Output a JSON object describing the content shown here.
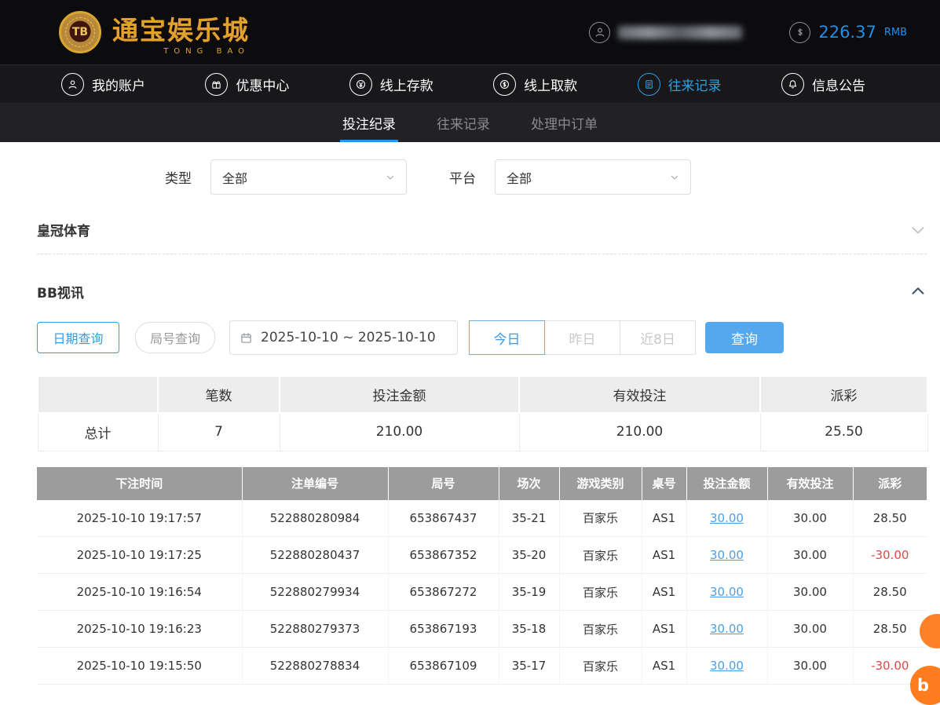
{
  "header": {
    "logo": {
      "badge": "TB",
      "title": "通宝娱乐城",
      "subtitle": "TONG BAO"
    },
    "balance": {
      "amount": "226.37",
      "currency": "RMB"
    }
  },
  "nav": {
    "items": [
      {
        "label": "我的账户",
        "icon": "account-icon",
        "active": false
      },
      {
        "label": "优惠中心",
        "icon": "promo-icon",
        "active": false
      },
      {
        "label": "线上存款",
        "icon": "deposit-icon",
        "active": false
      },
      {
        "label": "线上取款",
        "icon": "withdraw-icon",
        "active": false
      },
      {
        "label": "往来记录",
        "icon": "records-icon",
        "active": true
      },
      {
        "label": "信息公告",
        "icon": "announcement-icon",
        "active": false
      }
    ]
  },
  "tabs": {
    "items": [
      {
        "label": "投注纪录",
        "active": true
      },
      {
        "label": "往来记录",
        "active": false
      },
      {
        "label": "处理中订单",
        "active": false
      }
    ]
  },
  "filters": {
    "type_label": "类型",
    "type_value": "全部",
    "platform_label": "平台",
    "platform_value": "全部"
  },
  "sections": {
    "crown_title": "皇冠体育",
    "bb_title": "BB视讯"
  },
  "query": {
    "date_query_label": "日期查询",
    "round_query_label": "局号查询",
    "date_range": "2025-10-10 ~ 2025-10-10",
    "today_label": "今日",
    "yesterday_label": "昨日",
    "last8_label": "近8日",
    "search_label": "查询"
  },
  "summary": {
    "headers": [
      "",
      "笔数",
      "投注金额",
      "有效投注",
      "派彩"
    ],
    "total_label": "总计",
    "count": "7",
    "bet_amount": "210.00",
    "valid_bet": "210.00",
    "payout": "25.50"
  },
  "table": {
    "headers": [
      "下注时间",
      "注单编号",
      "局号",
      "场次",
      "游戏类别",
      "桌号",
      "投注金额",
      "有效投注",
      "派彩"
    ],
    "rows": [
      [
        "2025-10-10 19:17:57",
        "522880280984",
        "653867437",
        "35-21",
        "百家乐",
        "AS1",
        "30.00",
        "30.00",
        "28.50"
      ],
      [
        "2025-10-10 19:17:25",
        "522880280437",
        "653867352",
        "35-20",
        "百家乐",
        "AS1",
        "30.00",
        "30.00",
        "-30.00"
      ],
      [
        "2025-10-10 19:16:54",
        "522880279934",
        "653867272",
        "35-19",
        "百家乐",
        "AS1",
        "30.00",
        "30.00",
        "28.50"
      ],
      [
        "2025-10-10 19:16:23",
        "522880279373",
        "653867193",
        "35-18",
        "百家乐",
        "AS1",
        "30.00",
        "30.00",
        "28.50"
      ],
      [
        "2025-10-10 19:15:50",
        "522880278834",
        "653867109",
        "35-17",
        "百家乐",
        "AS1",
        "30.00",
        "30.00",
        "-30.00"
      ]
    ]
  },
  "widgets": {
    "chat_letter": "b"
  },
  "colors": {
    "accent_blue": "#2196f3",
    "nav_active": "#2d9fe0",
    "button_blue": "#55a8ee",
    "link_blue": "#4a9fe8",
    "negative_red": "#e64545",
    "brand_gold": "#dfa32b",
    "table_header_gray": "#9c9c9c"
  }
}
